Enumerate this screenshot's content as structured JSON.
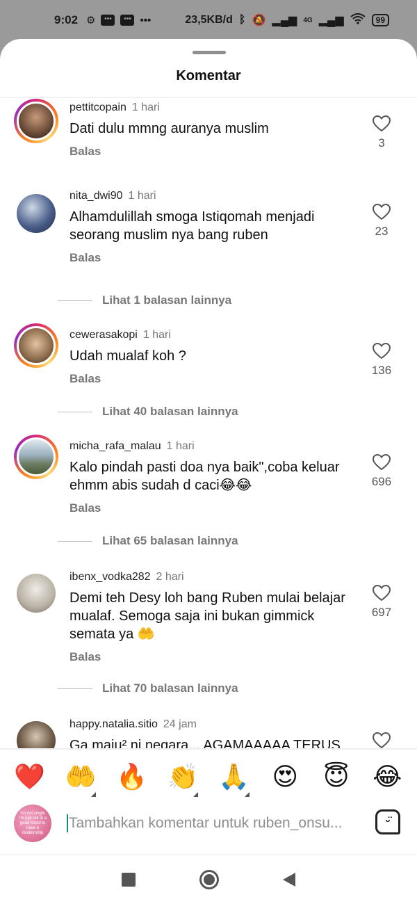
{
  "status_bar": {
    "time": "9:02",
    "network_speed": "23,5KB/d",
    "network_type": "4G",
    "battery": "99",
    "icons": [
      "gear-icon",
      "message-icon",
      "message-icon",
      "more-icon",
      "bluetooth-icon",
      "mute-icon",
      "signal-icon",
      "signal-icon",
      "wifi-icon",
      "battery-icon"
    ]
  },
  "sheet": {
    "title": "Komentar"
  },
  "reply_label": "Balas",
  "comments": [
    {
      "username": "pettitcopain",
      "time": "1 hari",
      "text": "Dati dulu mmng auranya muslim",
      "likes": "3",
      "has_story_ring": true,
      "more_replies": ""
    },
    {
      "username": "nita_dwi90",
      "time": "1 hari",
      "text": "Alhamdulillah smoga Istiqomah menjadi seorang muslim nya bang ruben",
      "likes": "23",
      "has_story_ring": false,
      "more_replies": "Lihat 1 balasan lainnya"
    },
    {
      "username": "cewerasakopi",
      "time": "1 hari",
      "text": "Udah mualaf koh ?",
      "likes": "136",
      "has_story_ring": true,
      "more_replies": "Lihat 40 balasan lainnya"
    },
    {
      "username": "micha_rafa_malau",
      "time": "1 hari",
      "text": "Kalo pindah pasti doa nya baik\",coba keluar ehmm abis sudah d caci😂😂",
      "likes": "696",
      "has_story_ring": true,
      "more_replies": "Lihat 65 balasan lainnya"
    },
    {
      "username": "ibenx_vodka282",
      "time": "2 hari",
      "text": "Demi teh Desy loh bang Ruben mulai belajar mualaf.  Semoga saja ini bukan gimmick semata ya 🤲",
      "likes": "697",
      "has_story_ring": false,
      "more_replies": "Lihat 70 balasan lainnya"
    },
    {
      "username": "happy.natalia.sitio",
      "time": "24 jam",
      "text": "Ga maju² ni negara... AGAMAAAAA TERUS",
      "likes": "",
      "has_story_ring": false,
      "more_replies": ""
    }
  ],
  "quick_reactions": [
    {
      "emoji": "❤️",
      "icon": "red-heart-emoji",
      "has_variants": false
    },
    {
      "emoji": "🤲",
      "icon": "palms-up-emoji",
      "has_variants": true
    },
    {
      "emoji": "🔥",
      "icon": "fire-emoji",
      "has_variants": false
    },
    {
      "emoji": "👏",
      "icon": "clapping-hands-emoji",
      "has_variants": true
    },
    {
      "emoji": "🙏",
      "icon": "folded-hands-emoji",
      "has_variants": true
    },
    {
      "emoji": "😍",
      "icon": "heart-eyes-emoji",
      "has_variants": false
    },
    {
      "emoji": "😇",
      "icon": "halo-emoji",
      "has_variants": false
    },
    {
      "emoji": "😂",
      "icon": "tears-of-joy-emoji",
      "has_variants": false
    }
  ],
  "composer": {
    "placeholder": "Tambahkan komentar untuk ruben_onsu...",
    "avatar_text": "I'm not single I'm just not in a good mood to have a relationship"
  },
  "colors": {
    "accent_caret": "#1a8a7a",
    "heart_red": "#e0245e",
    "story_ring": [
      "#d62976",
      "#fa7e1e",
      "#feda75",
      "#962fbf"
    ]
  }
}
